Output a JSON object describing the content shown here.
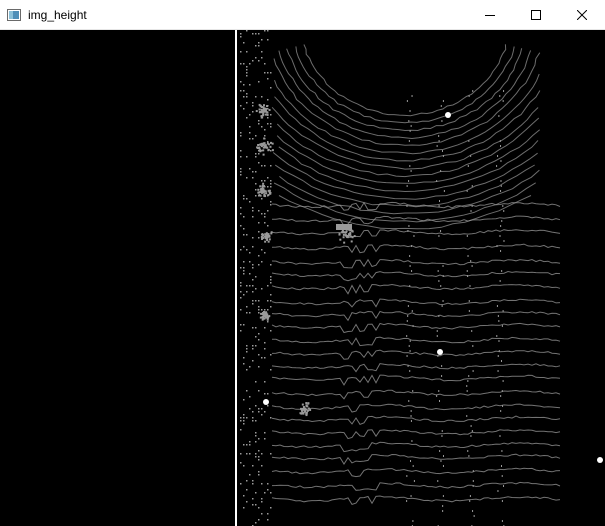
{
  "window": {
    "title": "img_height",
    "icons": {
      "app": "opencv-window-icon",
      "minimize": "minimize-icon",
      "maximize": "maximize-icon",
      "close": "close-icon"
    }
  },
  "image": {
    "description_kind": "lidar-height-map",
    "colors": {
      "background": "#000000",
      "points": "#9a9a9a",
      "highlight": "#ffffff"
    }
  }
}
